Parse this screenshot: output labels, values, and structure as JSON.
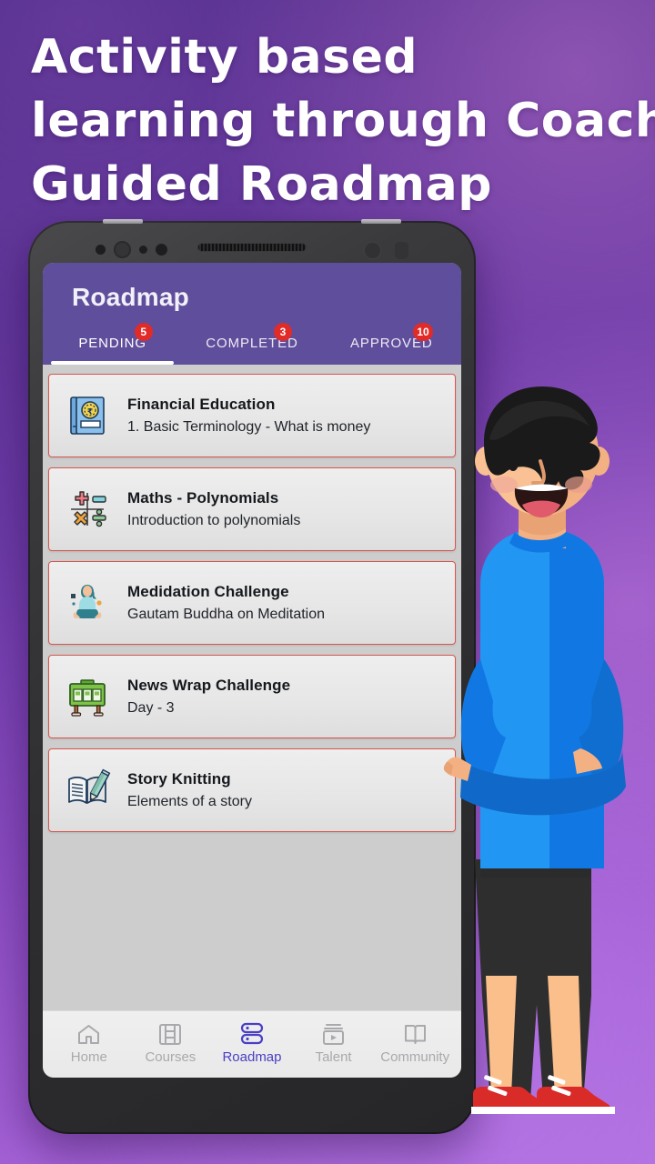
{
  "headline": {
    "line1": "Activity based",
    "line2": "learning through Coach",
    "line3": "Guided Roadmap"
  },
  "colors": {
    "background_purple": "#6b3aa6",
    "header_purple": "#5f4e9c",
    "badge_red": "#e02b28",
    "card_border_red": "#d4564e",
    "active_nav_purple": "#4a3fc4",
    "screen_gray": "#cdcdcd"
  },
  "app": {
    "header": {
      "title": "Roadmap"
    },
    "tabs": [
      {
        "label": "PENDING",
        "badge": "5",
        "active": true
      },
      {
        "label": "COMPLETED",
        "badge": "3",
        "active": false
      },
      {
        "label": "APPROVED",
        "badge": "10",
        "active": false
      }
    ],
    "cards": [
      {
        "title": "Financial Education",
        "subtitle": "1. Basic Terminology - What is money",
        "icon": "book-rupee-icon"
      },
      {
        "title": "Maths - Polynomials",
        "subtitle": "Introduction to polynomials",
        "icon": "math-symbols-icon"
      },
      {
        "title": "Medidation Challenge",
        "subtitle": "Gautam Buddha on Meditation",
        "icon": "meditation-icon"
      },
      {
        "title": "News Wrap Challenge",
        "subtitle": "Day - 3",
        "icon": "newsstand-icon"
      },
      {
        "title": "Story Knitting",
        "subtitle": "Elements of a story",
        "icon": "book-pencil-icon"
      }
    ],
    "bottom_nav": [
      {
        "label": "Home",
        "icon": "home-icon",
        "active": false
      },
      {
        "label": "Courses",
        "icon": "film-icon",
        "active": false
      },
      {
        "label": "Roadmap",
        "icon": "roadmap-icon",
        "active": true
      },
      {
        "label": "Talent",
        "icon": "video-play-icon",
        "active": false
      },
      {
        "label": "Community",
        "icon": "open-book-icon",
        "active": false
      }
    ]
  },
  "illustration": {
    "name": "smiling-boy-arms-crossed"
  }
}
